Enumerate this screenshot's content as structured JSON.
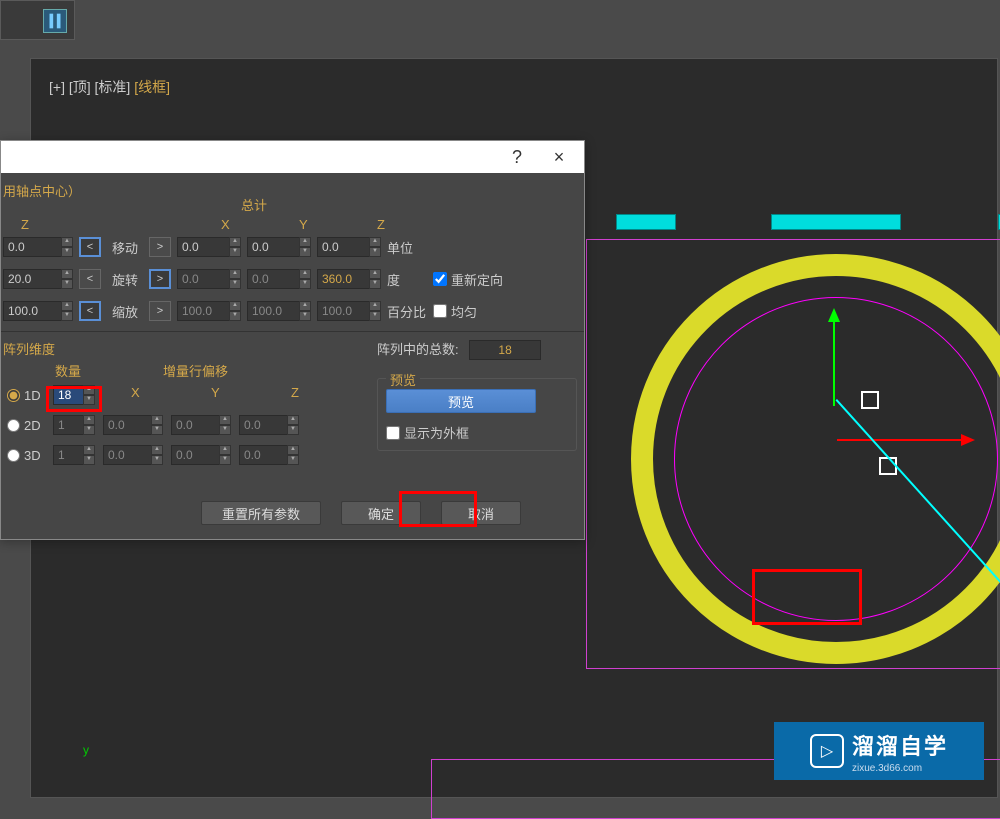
{
  "toolbar": {
    "icon": "align-icon"
  },
  "viewport": {
    "label_prefix": "[+] [顶] [标准] ",
    "label_wire": "[线框]",
    "axis_y": "y"
  },
  "dialog": {
    "help": "?",
    "close": "×",
    "pivot_label": "用轴点中心）",
    "total_header": "总计",
    "col_z": "Z",
    "col_x": "X",
    "col_y": "Y",
    "move_label": "移动",
    "rotate_label": "旋转",
    "scale_label": "缩放",
    "unit_move": "单位",
    "unit_rot": "度",
    "unit_scale": "百分比",
    "reorient": "重新定向",
    "uniform": "均匀",
    "vals": {
      "move_z": "0.0",
      "move_x2": "0.0",
      "move_y2": "0.0",
      "move_z2": "0.0",
      "rot_z": "20.0",
      "rot_x2": "0.0",
      "rot_y2": "0.0",
      "rot_z2": "360.0",
      "scale_z": "100.0",
      "scale_x2": "100.0",
      "scale_y2": "100.0",
      "scale_z2": "100.0"
    },
    "dim": {
      "title": "阵列维度",
      "count_hdr": "数量",
      "offset_hdr": "增量行偏移",
      "d1": "1D",
      "d2": "2D",
      "d3": "3D",
      "n1": "18",
      "n2": "1",
      "n3": "1",
      "x": "X",
      "y": "Y",
      "z": "Z",
      "v2x": "0.0",
      "v2y": "0.0",
      "v2z": "0.0",
      "v3x": "0.0",
      "v3y": "0.0",
      "v3z": "0.0"
    },
    "array_total_label": "阵列中的总数:",
    "array_total_value": "18",
    "preview_group": "预览",
    "preview_btn": "预览",
    "display_bbox": "显示为外框",
    "reset_btn": "重置所有参数",
    "ok_btn": "确定",
    "cancel_btn": "取消"
  },
  "watermark": {
    "title": "溜溜自学",
    "sub": "zixue.3d66.com"
  }
}
